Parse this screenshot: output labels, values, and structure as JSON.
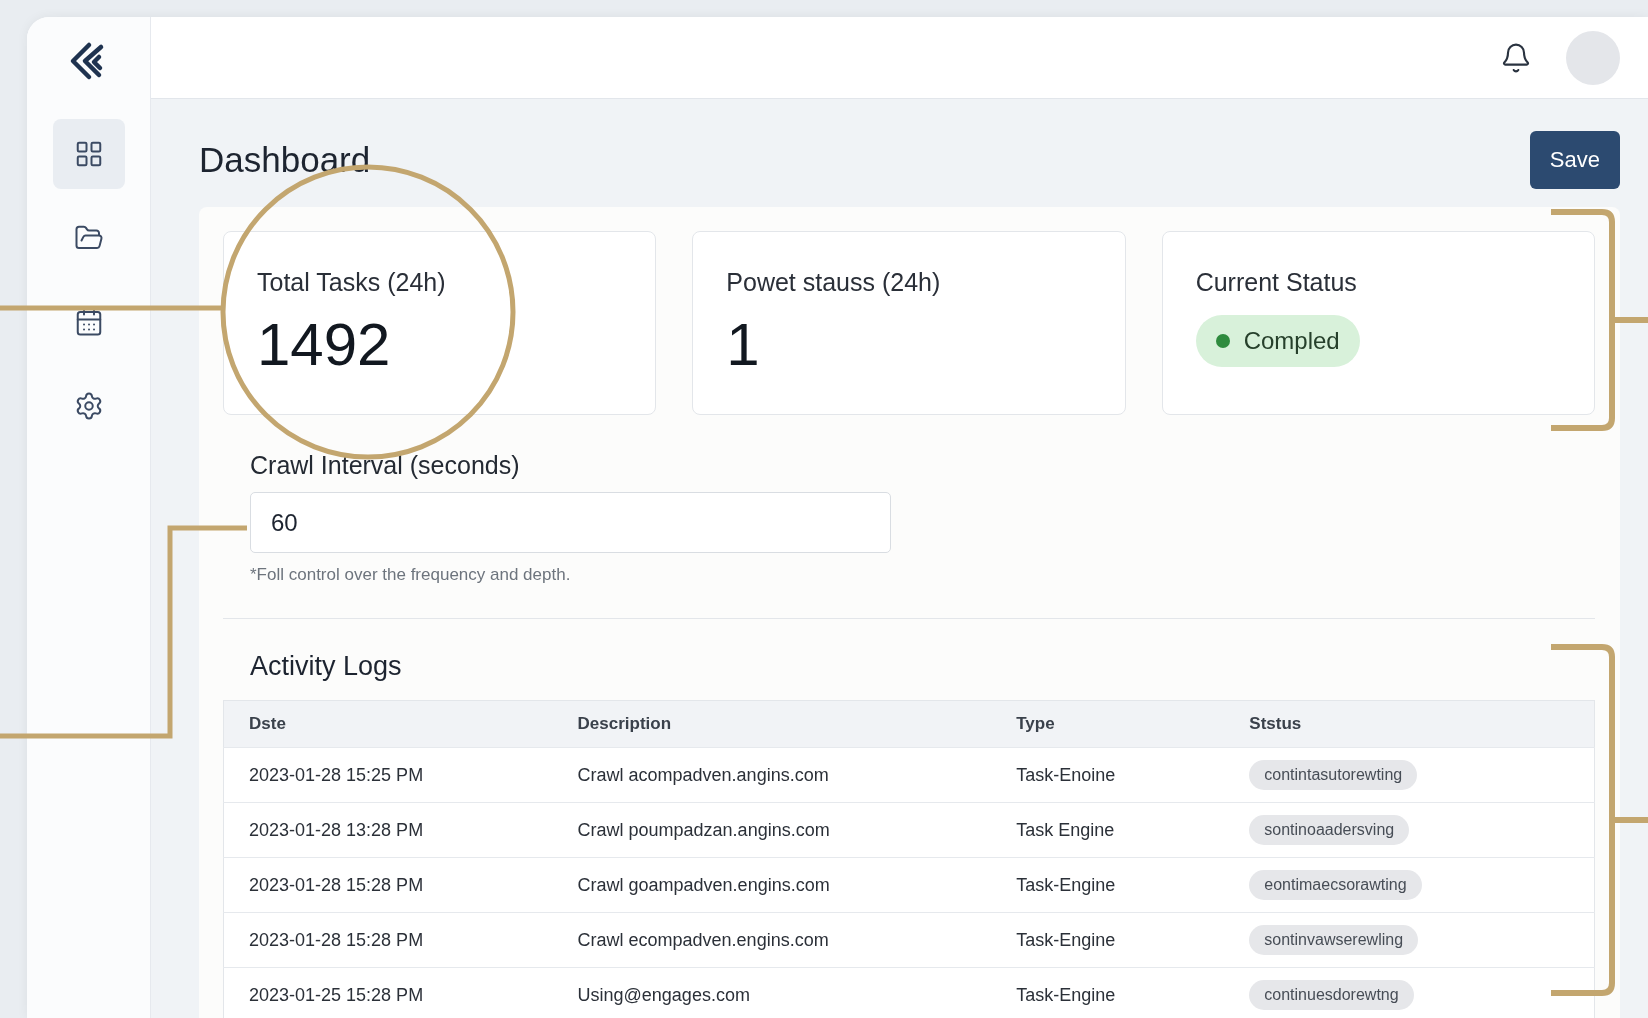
{
  "sidebar": {
    "items": [
      {
        "kind": "grid",
        "selected": true
      },
      {
        "kind": "folder",
        "selected": false
      },
      {
        "kind": "calendar",
        "selected": false
      },
      {
        "kind": "settings",
        "selected": false
      }
    ]
  },
  "page_title": "Dashboard",
  "save_button": "Save",
  "stats": [
    {
      "kind": "number",
      "label": "Total Tasks (24h)",
      "value": "1492"
    },
    {
      "kind": "number",
      "label": "Powet stauss (24h)",
      "value": "1"
    },
    {
      "kind": "status",
      "label": "Current Status",
      "value": "Compled"
    }
  ],
  "crawl_interval": {
    "label": "Crawl Interval (seconds)",
    "value": "60",
    "hint": "*Foll control over the frequency and depth."
  },
  "activity_logs": {
    "title": "Activity Logs",
    "columns": [
      "Dste",
      "Description",
      "Type",
      "Ststus"
    ],
    "rows": [
      [
        "2023-01-28 15:25 PM",
        "Crawl acompadven.angins.com",
        "Task-Enoine",
        "contintasutorewting"
      ],
      [
        "2023-01-28 13:28 PM",
        "Crawl poumpadzan.angins.com",
        "Task Engine",
        "sontinoaadersving"
      ],
      [
        "2023-01-28 15:28 PM",
        "Crawl goampadven.engins.com",
        "Task-Engine",
        "eontimaecsorawting"
      ],
      [
        "2023-01-28 15:28 PM",
        "Crawl ecompadven.engins.com",
        "Task-Engine",
        "sontinvawserewling"
      ],
      [
        "2023-01-25 15:28 PM",
        "Using@engages.com",
        "Task-Engine",
        "continuesdorewtng"
      ]
    ]
  }
}
